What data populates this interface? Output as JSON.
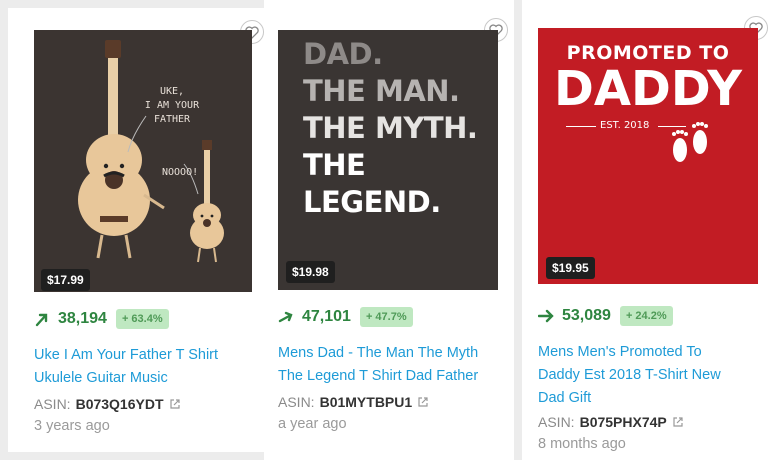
{
  "products": [
    {
      "price": "$17.99",
      "rank": "38,194",
      "trend_arrow": "arrow-up-right-steep-icon",
      "change": "+ 63.4%",
      "title_line1": "Uke I Am Your Father T Shirt",
      "title_line2": "Ukulele Guitar Music",
      "title_line3": "",
      "asin_label": "ASIN:",
      "asin": "B073Q16YDT",
      "age": "3 years ago",
      "art": {
        "bg": "#3b3431",
        "speech1": [
          "UKE,",
          "I AM YOUR",
          "FATHER"
        ],
        "speech2": "NOOOO!"
      }
    },
    {
      "price": "$19.98",
      "rank": "47,101",
      "trend_arrow": "arrow-up-right-icon",
      "change": "+ 47.7%",
      "title_line1": "Mens Dad - The Man The Myth",
      "title_line2": "The Legend T Shirt Dad Father",
      "title_line3": "",
      "asin_label": "ASIN:",
      "asin": "B01MYTBPU1",
      "age": "a year ago",
      "art": {
        "bg": "#3a3533",
        "line1": "DAD.",
        "line2": "THE MAN.",
        "line3": "THE MYTH.",
        "line4": "THE LEGEND."
      }
    },
    {
      "price": "$19.95",
      "rank": "53,089",
      "trend_arrow": "arrow-right-icon",
      "change": "+ 24.2%",
      "title_line1": "Mens Men's Promoted To",
      "title_line2": "Daddy Est 2018 T-Shirt New",
      "title_line3": "Dad Gift",
      "asin_label": "ASIN:",
      "asin": "B075PHX74P",
      "age": "8 months ago",
      "art": {
        "bg": "#c21c24",
        "line1": "PROMOTED TO",
        "line2": "DADDY",
        "line3": "EST. 2018"
      }
    }
  ],
  "colors": {
    "link": "#1e9bd7",
    "rank": "#2e8540",
    "badge_bg": "#bfe8c1"
  }
}
